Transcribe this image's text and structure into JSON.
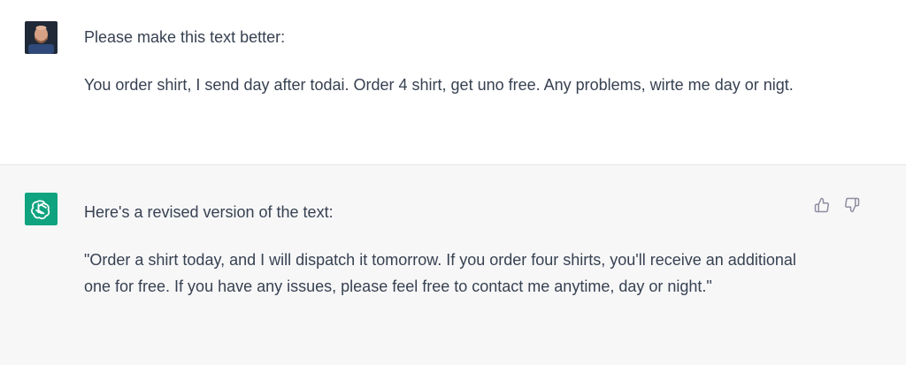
{
  "conversation": {
    "user_message": {
      "lines": [
        "Please make this text better:",
        "You order shirt, I send day after todai. Order 4 shirt, get uno free. Any problems, wirte me day or nigt."
      ]
    },
    "assistant_message": {
      "lines": [
        "Here's a revised version of the text:",
        "\"Order a shirt today, and I will dispatch it tomorrow. If you order four shirts, you'll receive an additional one for free. If you have any issues, please feel free to contact me anytime, day or night.\""
      ],
      "feedback_icons": [
        "thumbs-up-icon",
        "thumbs-down-icon"
      ]
    }
  },
  "colors": {
    "assistant_avatar_bg": "#10a37f",
    "assistant_row_bg": "#f7f7f8",
    "text": "#374151",
    "icon": "#8e8ea0"
  }
}
